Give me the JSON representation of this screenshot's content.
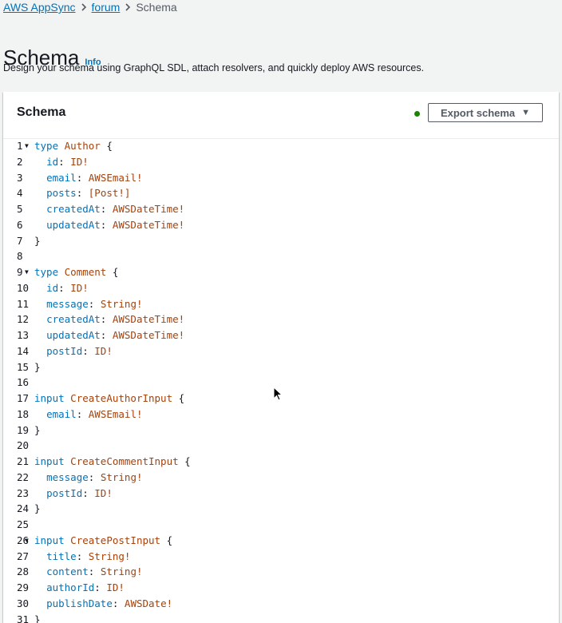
{
  "breadcrumb": {
    "items": [
      {
        "label": "AWS AppSync",
        "link": true
      },
      {
        "label": "forum",
        "link": true
      },
      {
        "label": "Schema",
        "link": false
      }
    ],
    "separator": ">"
  },
  "page": {
    "title": "Schema",
    "info_label": "Info",
    "description": "Design your schema using GraphQL SDL, attach resolvers, and quickly deploy AWS resources."
  },
  "panel": {
    "title": "Schema",
    "export_label": "Export schema",
    "status_color": "#1d8102"
  },
  "editor": {
    "lines": [
      {
        "n": "1",
        "fold": true,
        "indent": "",
        "tokens": [
          {
            "t": "type",
            "c": "kw"
          },
          {
            "t": " ",
            "c": "punct"
          },
          {
            "t": "Author",
            "c": "type"
          },
          {
            "t": " {",
            "c": "punct"
          }
        ]
      },
      {
        "n": "2",
        "fold": false,
        "indent": "  ",
        "tokens": [
          {
            "t": "id",
            "c": "field"
          },
          {
            "t": ": ",
            "c": "punct"
          },
          {
            "t": "ID!",
            "c": "type"
          }
        ]
      },
      {
        "n": "3",
        "fold": false,
        "indent": "  ",
        "tokens": [
          {
            "t": "email",
            "c": "field"
          },
          {
            "t": ": ",
            "c": "punct"
          },
          {
            "t": "AWSEmail!",
            "c": "type"
          }
        ]
      },
      {
        "n": "4",
        "fold": false,
        "indent": "  ",
        "tokens": [
          {
            "t": "posts",
            "c": "field"
          },
          {
            "t": ": ",
            "c": "punct"
          },
          {
            "t": "[Post!]",
            "c": "type"
          }
        ]
      },
      {
        "n": "5",
        "fold": false,
        "indent": "  ",
        "tokens": [
          {
            "t": "createdAt",
            "c": "field"
          },
          {
            "t": ": ",
            "c": "punct"
          },
          {
            "t": "AWSDateTime!",
            "c": "type"
          }
        ]
      },
      {
        "n": "6",
        "fold": false,
        "indent": "  ",
        "tokens": [
          {
            "t": "updatedAt",
            "c": "field"
          },
          {
            "t": ": ",
            "c": "punct"
          },
          {
            "t": "AWSDateTime!",
            "c": "type"
          }
        ]
      },
      {
        "n": "7",
        "fold": false,
        "indent": "",
        "tokens": [
          {
            "t": "}",
            "c": "punct"
          }
        ]
      },
      {
        "n": "8",
        "fold": false,
        "indent": "",
        "tokens": []
      },
      {
        "n": "9",
        "fold": true,
        "indent": "",
        "tokens": [
          {
            "t": "type",
            "c": "kw"
          },
          {
            "t": " ",
            "c": "punct"
          },
          {
            "t": "Comment",
            "c": "type"
          },
          {
            "t": " {",
            "c": "punct"
          }
        ]
      },
      {
        "n": "10",
        "fold": false,
        "indent": "  ",
        "tokens": [
          {
            "t": "id",
            "c": "field"
          },
          {
            "t": ": ",
            "c": "punct"
          },
          {
            "t": "ID!",
            "c": "type"
          }
        ]
      },
      {
        "n": "11",
        "fold": false,
        "indent": "  ",
        "tokens": [
          {
            "t": "message",
            "c": "field"
          },
          {
            "t": ": ",
            "c": "punct"
          },
          {
            "t": "String!",
            "c": "type"
          }
        ]
      },
      {
        "n": "12",
        "fold": false,
        "indent": "  ",
        "tokens": [
          {
            "t": "createdAt",
            "c": "field"
          },
          {
            "t": ": ",
            "c": "punct"
          },
          {
            "t": "AWSDateTime!",
            "c": "type"
          }
        ]
      },
      {
        "n": "13",
        "fold": false,
        "indent": "  ",
        "tokens": [
          {
            "t": "updatedAt",
            "c": "field"
          },
          {
            "t": ": ",
            "c": "punct"
          },
          {
            "t": "AWSDateTime!",
            "c": "type"
          }
        ]
      },
      {
        "n": "14",
        "fold": false,
        "indent": "  ",
        "tokens": [
          {
            "t": "postId",
            "c": "field"
          },
          {
            "t": ": ",
            "c": "punct"
          },
          {
            "t": "ID!",
            "c": "type"
          }
        ]
      },
      {
        "n": "15",
        "fold": false,
        "indent": "",
        "tokens": [
          {
            "t": "}",
            "c": "punct"
          }
        ]
      },
      {
        "n": "16",
        "fold": false,
        "indent": "",
        "tokens": []
      },
      {
        "n": "17",
        "fold": false,
        "indent": "",
        "tokens": [
          {
            "t": "input",
            "c": "kw"
          },
          {
            "t": " ",
            "c": "punct"
          },
          {
            "t": "CreateAuthorInput",
            "c": "type"
          },
          {
            "t": " {",
            "c": "punct"
          }
        ]
      },
      {
        "n": "18",
        "fold": false,
        "indent": "  ",
        "tokens": [
          {
            "t": "email",
            "c": "field"
          },
          {
            "t": ": ",
            "c": "punct"
          },
          {
            "t": "AWSEmail!",
            "c": "type"
          }
        ]
      },
      {
        "n": "19",
        "fold": false,
        "indent": "",
        "tokens": [
          {
            "t": "}",
            "c": "punct"
          }
        ]
      },
      {
        "n": "20",
        "fold": false,
        "indent": "",
        "tokens": []
      },
      {
        "n": "21",
        "fold": false,
        "indent": "",
        "tokens": [
          {
            "t": "input",
            "c": "kw"
          },
          {
            "t": " ",
            "c": "punct"
          },
          {
            "t": "CreateCommentInput",
            "c": "type"
          },
          {
            "t": " {",
            "c": "punct"
          }
        ]
      },
      {
        "n": "22",
        "fold": false,
        "indent": "  ",
        "tokens": [
          {
            "t": "message",
            "c": "field"
          },
          {
            "t": ": ",
            "c": "punct"
          },
          {
            "t": "String!",
            "c": "type"
          }
        ]
      },
      {
        "n": "23",
        "fold": false,
        "indent": "  ",
        "tokens": [
          {
            "t": "postId",
            "c": "field"
          },
          {
            "t": ": ",
            "c": "punct"
          },
          {
            "t": "ID!",
            "c": "type"
          }
        ]
      },
      {
        "n": "24",
        "fold": false,
        "indent": "",
        "tokens": [
          {
            "t": "}",
            "c": "punct"
          }
        ]
      },
      {
        "n": "25",
        "fold": false,
        "indent": "",
        "tokens": []
      },
      {
        "n": "26",
        "fold": true,
        "indent": "",
        "tokens": [
          {
            "t": "input",
            "c": "kw"
          },
          {
            "t": " ",
            "c": "punct"
          },
          {
            "t": "CreatePostInput",
            "c": "type"
          },
          {
            "t": " {",
            "c": "punct"
          }
        ]
      },
      {
        "n": "27",
        "fold": false,
        "indent": "  ",
        "tokens": [
          {
            "t": "title",
            "c": "field"
          },
          {
            "t": ": ",
            "c": "punct"
          },
          {
            "t": "String!",
            "c": "type"
          }
        ]
      },
      {
        "n": "28",
        "fold": false,
        "indent": "  ",
        "tokens": [
          {
            "t": "content",
            "c": "field"
          },
          {
            "t": ": ",
            "c": "punct"
          },
          {
            "t": "String!",
            "c": "type"
          }
        ]
      },
      {
        "n": "29",
        "fold": false,
        "indent": "  ",
        "tokens": [
          {
            "t": "authorId",
            "c": "field"
          },
          {
            "t": ": ",
            "c": "punct"
          },
          {
            "t": "ID!",
            "c": "type"
          }
        ]
      },
      {
        "n": "30",
        "fold": false,
        "indent": "  ",
        "tokens": [
          {
            "t": "publishDate",
            "c": "field"
          },
          {
            "t": ": ",
            "c": "punct"
          },
          {
            "t": "AWSDate!",
            "c": "type"
          }
        ]
      },
      {
        "n": "31",
        "fold": false,
        "indent": "",
        "tokens": [
          {
            "t": "}",
            "c": "punct"
          }
        ]
      }
    ]
  }
}
